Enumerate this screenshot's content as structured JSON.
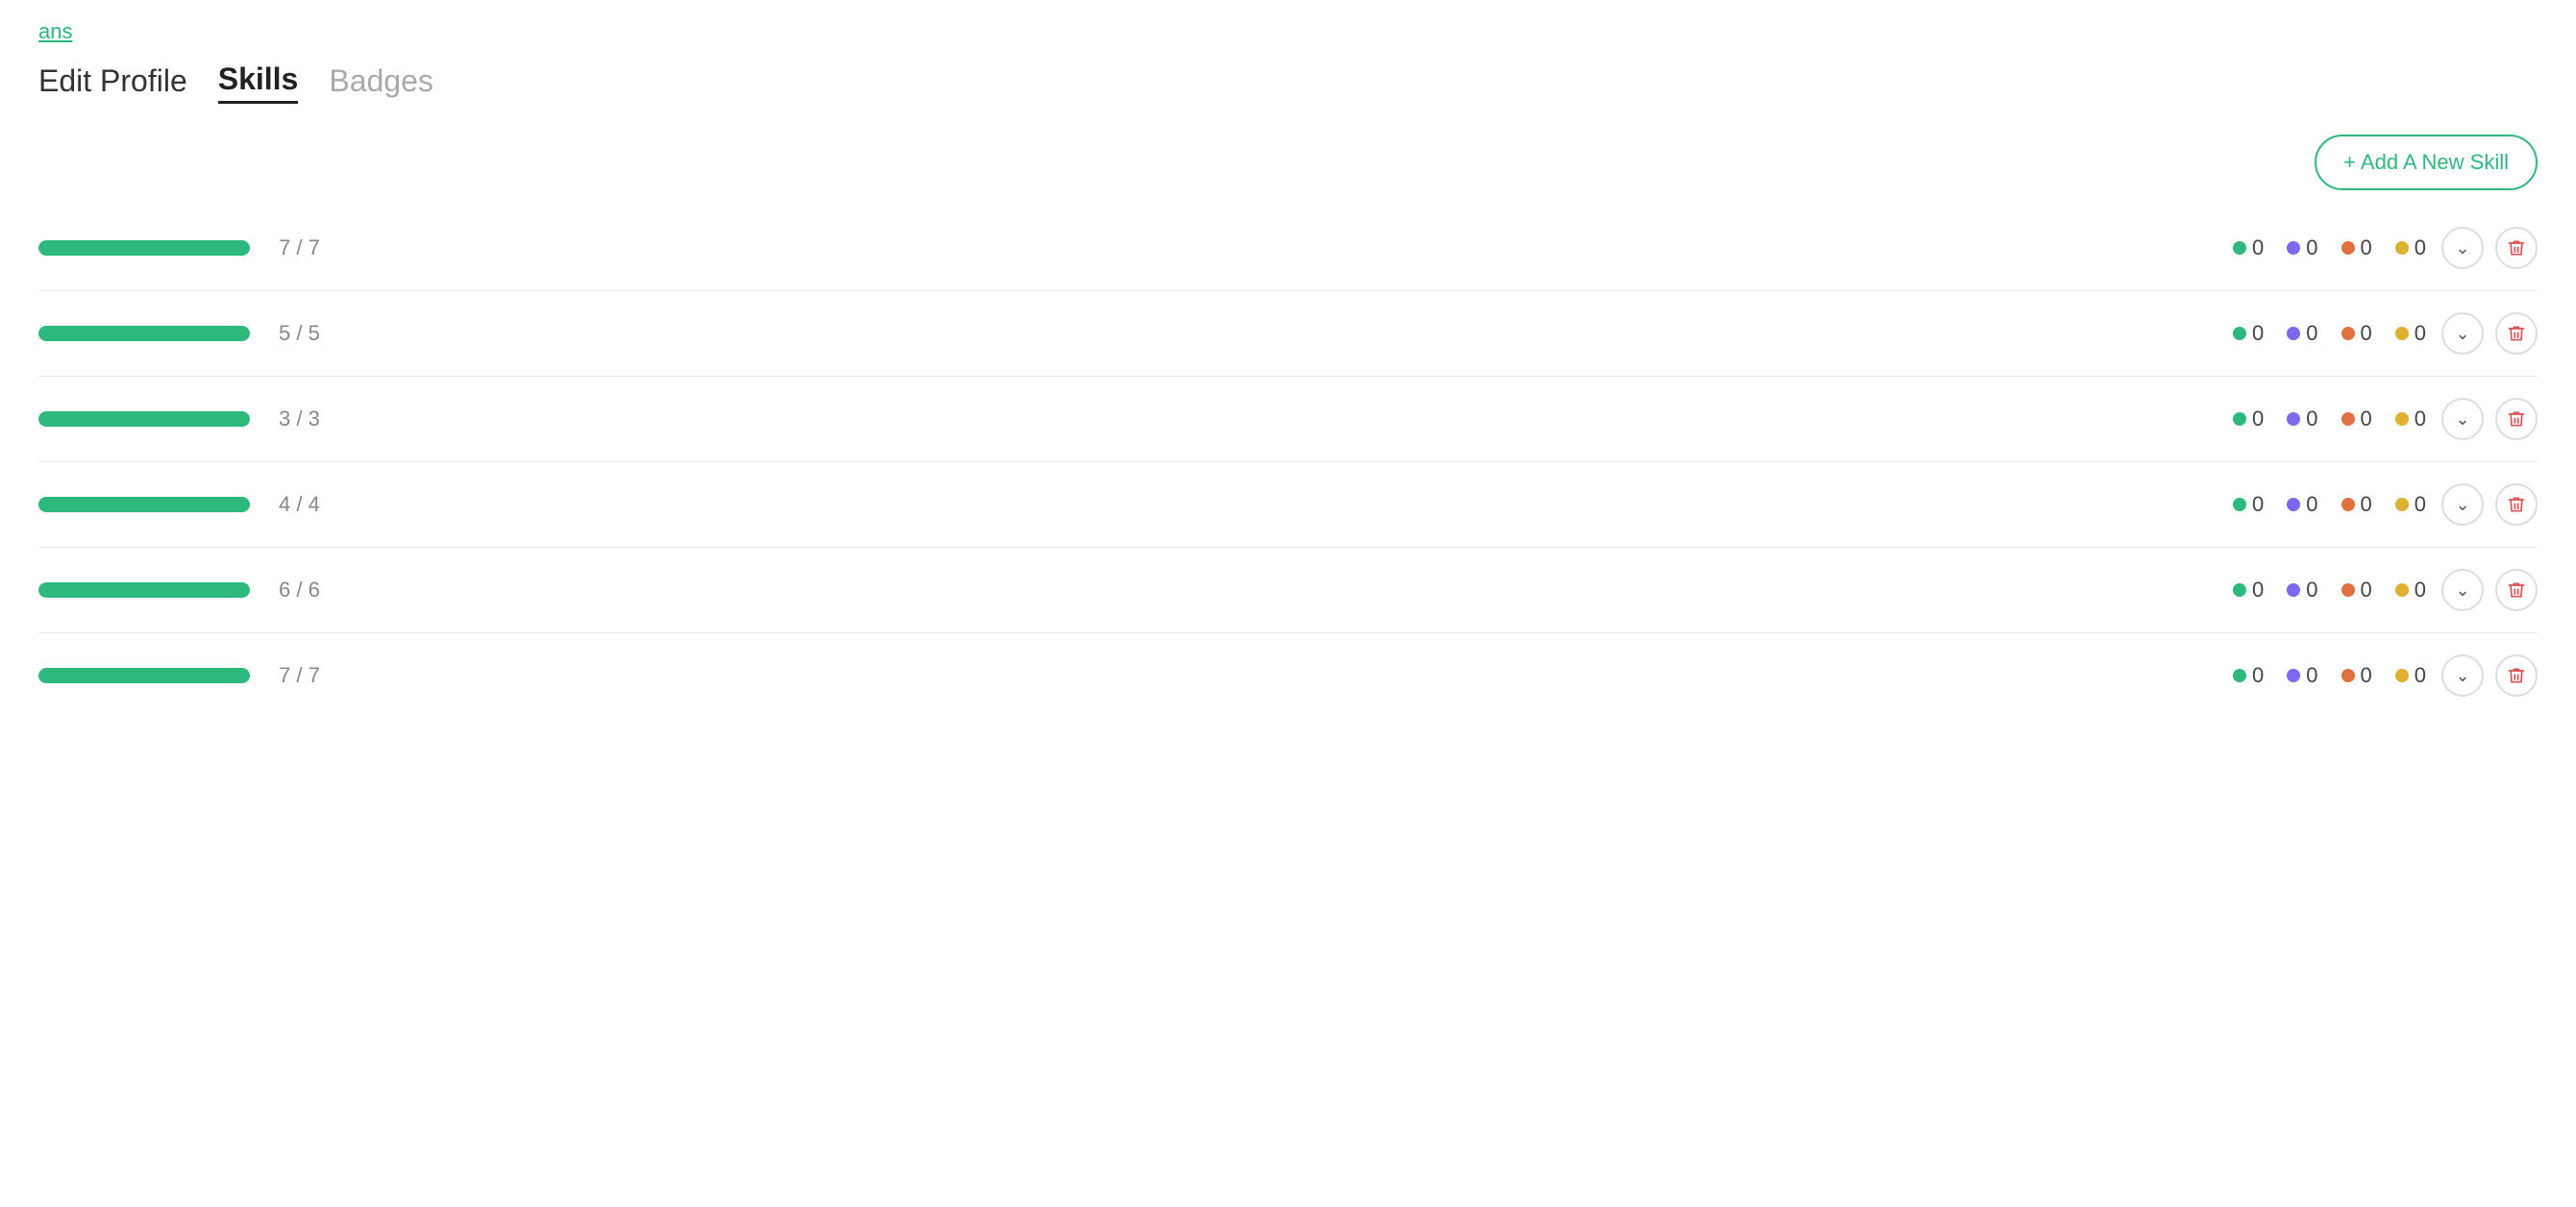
{
  "topLink": {
    "label": "ans"
  },
  "tabs": [
    {
      "id": "edit-profile",
      "label": "Edit Profile",
      "active": false
    },
    {
      "id": "skills",
      "label": "Skills",
      "active": true
    },
    {
      "id": "badges",
      "label": "Badges",
      "active": false
    }
  ],
  "toolbar": {
    "addSkillLabel": "+ Add A New Skill"
  },
  "skills": [
    {
      "current": 7,
      "max": 7,
      "label": "7 / 7",
      "progress": 100,
      "green": 0,
      "purple": 0,
      "orange": 0,
      "yellow": 0
    },
    {
      "current": 5,
      "max": 5,
      "label": "5 / 5",
      "progress": 100,
      "green": 0,
      "purple": 0,
      "orange": 0,
      "yellow": 0
    },
    {
      "current": 3,
      "max": 3,
      "label": "3 / 3",
      "progress": 100,
      "green": 0,
      "purple": 0,
      "orange": 0,
      "yellow": 0
    },
    {
      "current": 4,
      "max": 4,
      "label": "4 / 4",
      "progress": 100,
      "green": 0,
      "purple": 0,
      "orange": 0,
      "yellow": 0
    },
    {
      "current": 6,
      "max": 6,
      "label": "6 / 6",
      "progress": 100,
      "green": 0,
      "purple": 0,
      "orange": 0,
      "yellow": 0
    },
    {
      "current": 7,
      "max": 7,
      "label": "7 / 7",
      "progress": 100,
      "green": 0,
      "purple": 0,
      "orange": 0,
      "yellow": 0
    }
  ],
  "icons": {
    "chevron": "&#8964;",
    "trash": "&#128465;"
  },
  "colors": {
    "green": "#2db87c",
    "accent": "#2db87c"
  }
}
